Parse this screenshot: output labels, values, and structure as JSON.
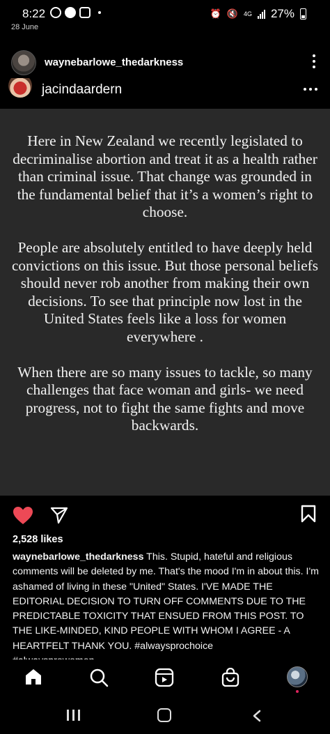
{
  "status": {
    "time": "8:22",
    "date": "28 June",
    "battery": "27%",
    "network": "4G"
  },
  "post": {
    "author": "waynebarlowe_thedarkness",
    "inner_author": "jacindaardern",
    "quote_paragraphs": [
      "Here in New Zealand we  recently legislated to decriminalise abortion and treat it as a health rather than criminal issue. That change was grounded in the fundamental belief that it’s a women’s right to choose.",
      "People are absolutely entitled to have deeply held convictions on this issue. But those personal beliefs should never rob another from making their own decisions. To see that principle now lost in the United States feels like a loss for women everywhere .",
      "When there are so many issues to tackle, so many challenges that face woman and girls- we need progress, not to fight the same fights and move backwards."
    ],
    "likes": "2,528 likes",
    "caption_user": "waynebarlowe_thedarkness",
    "caption_text": " This.  Stupid, hateful and religious comments will be deleted by me. That's the mood I'm in about this. I'm ashamed of living in these \"United\" States. I'VE MADE THE EDITORIAL DECISION TO TURN OFF COMMENTS DUE TO THE PREDICTABLE TOXICITY THAT ENSUED FROM THIS POST. TO THE LIKE-MINDED, KIND PEOPLE WITH WHOM I AGREE - A HEARTFELT THANK YOU. #alwaysprochoice",
    "caption_overflow": "#alwaysprowomen"
  },
  "colors": {
    "like_red": "#ed4956",
    "card_bg": "#292929"
  },
  "icons": [
    "home-icon",
    "search-icon",
    "reels-icon",
    "shop-icon",
    "heart-icon",
    "send-icon",
    "bookmark-icon"
  ]
}
